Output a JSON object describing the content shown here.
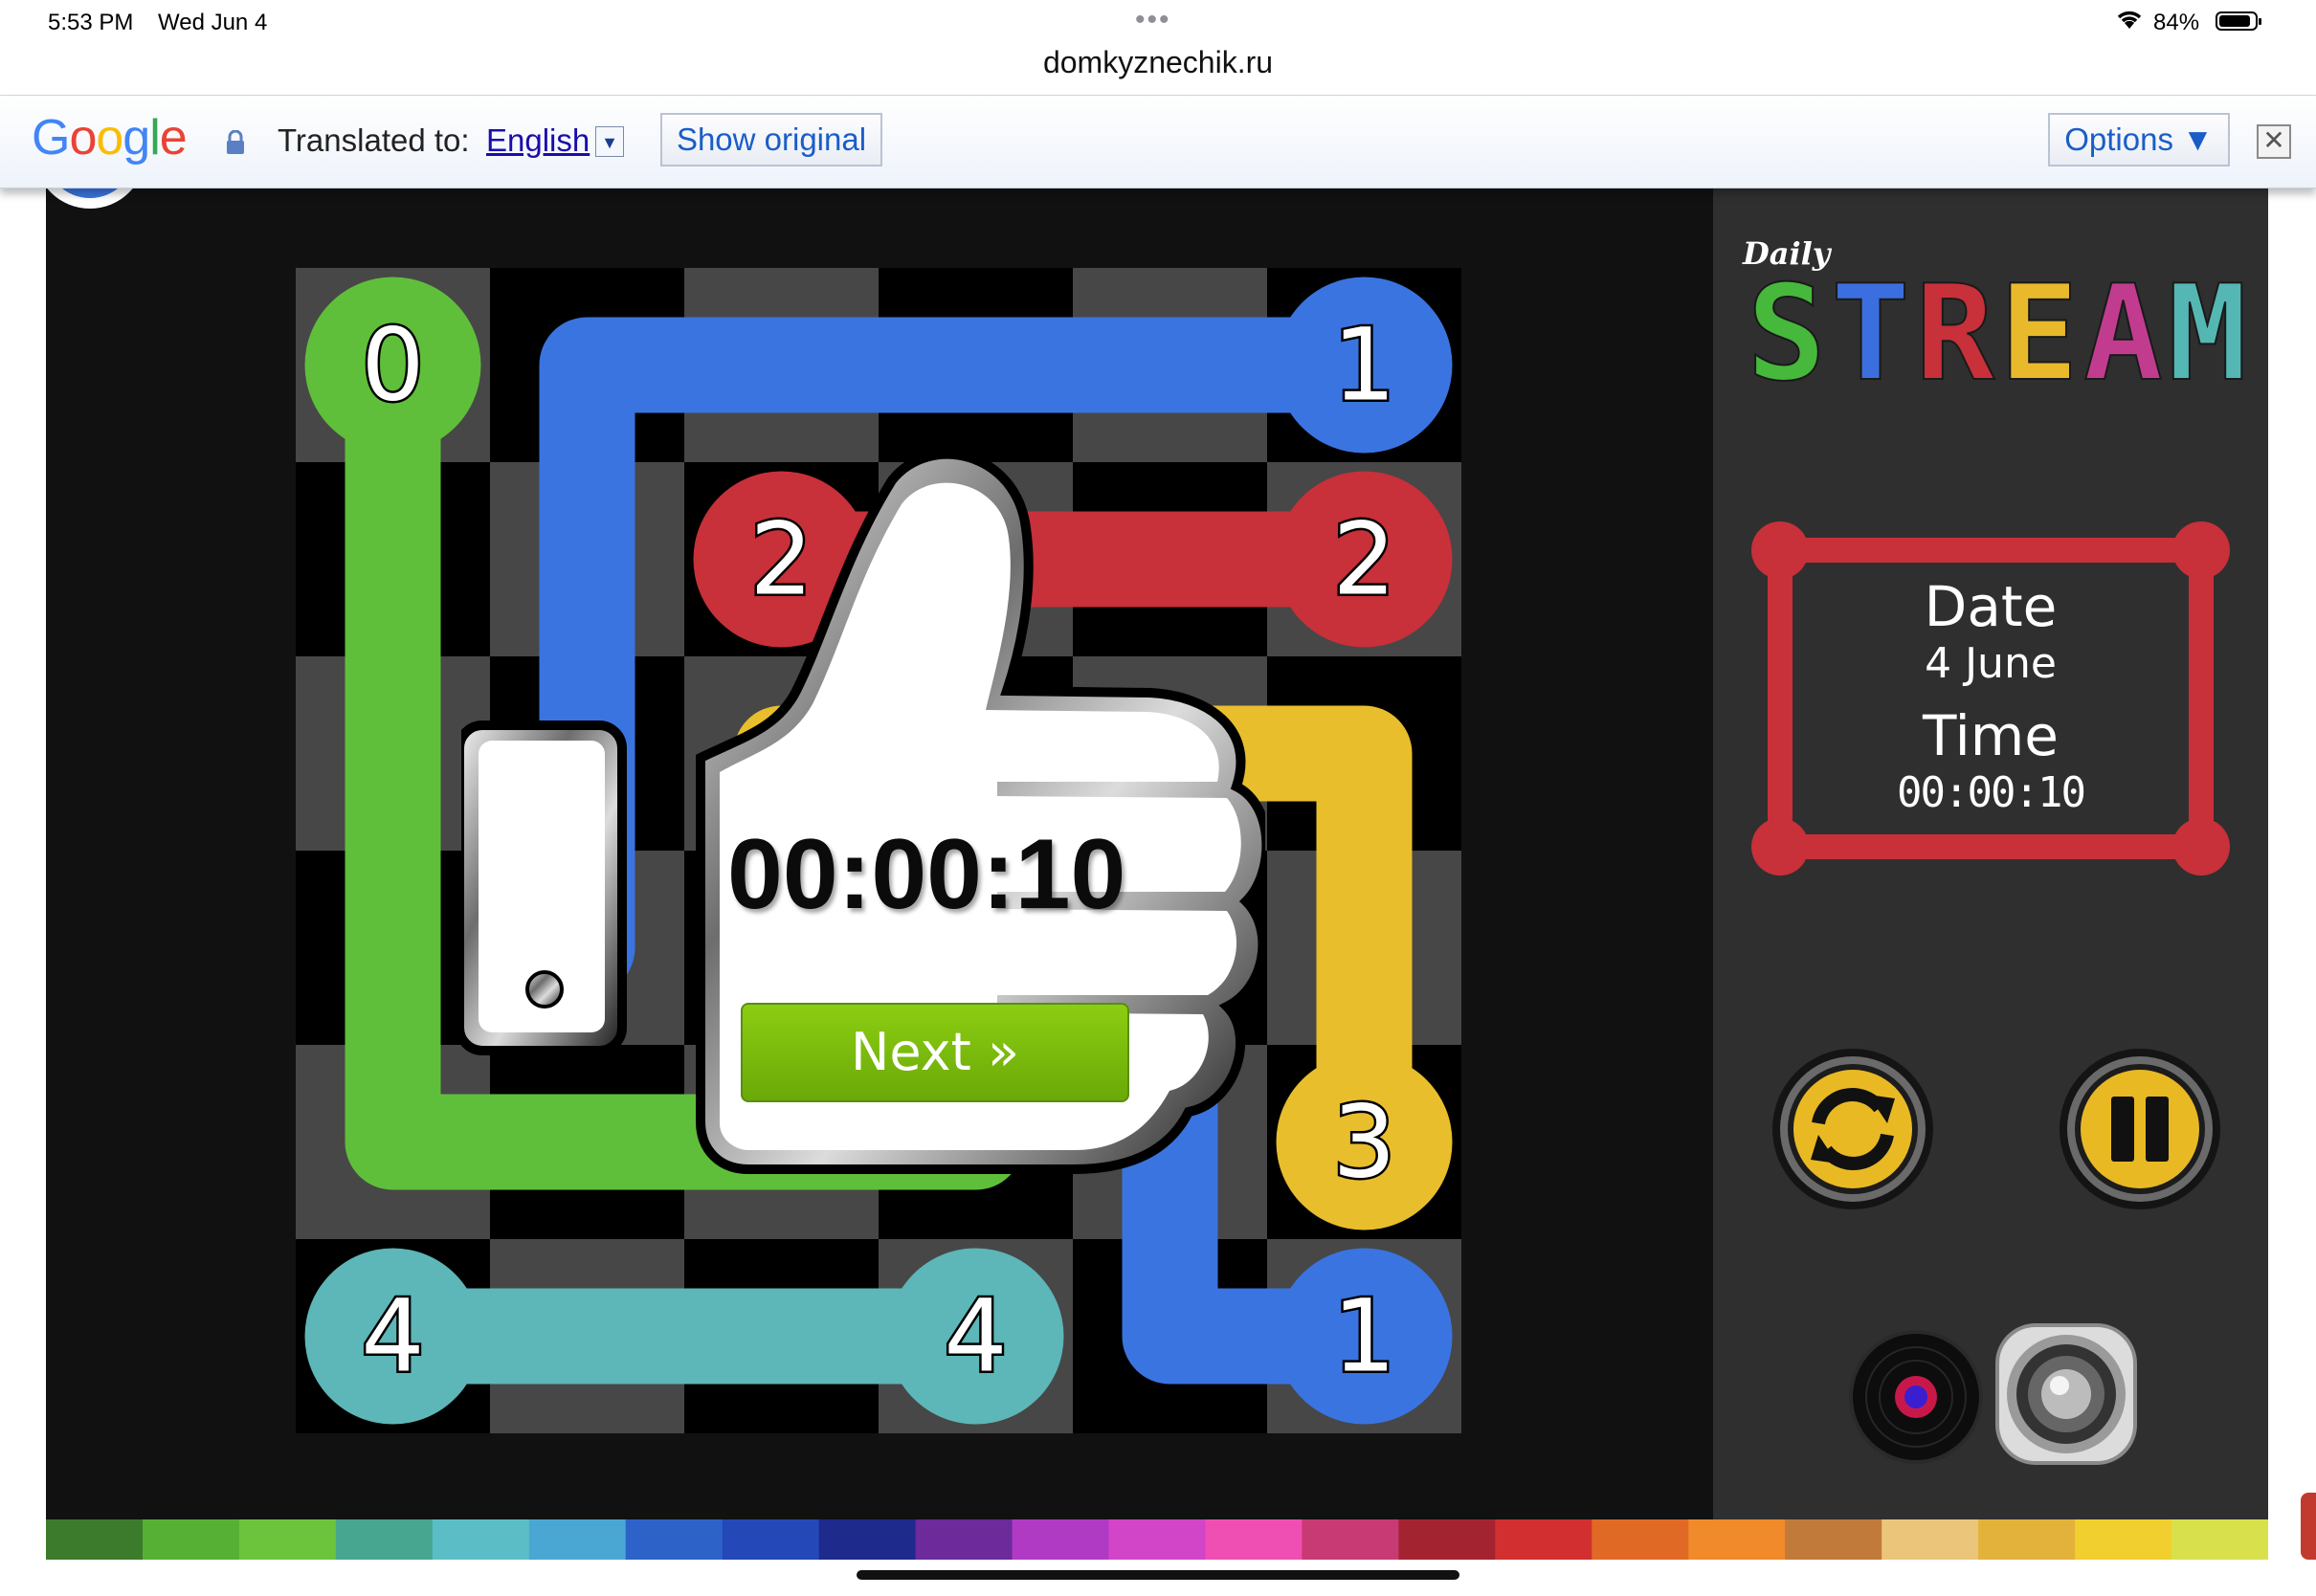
{
  "status_bar": {
    "time": "5:53 PM",
    "date": "Wed Jun 4",
    "battery_percent": "84%",
    "battery_level": 0.84
  },
  "browser": {
    "url": "domkyznechik.ru"
  },
  "translate_bar": {
    "logo": "Google",
    "translated_to_label": "Translated to:",
    "language": "English",
    "show_original_label": "Show original",
    "options_label": "Options ▼",
    "close_glyph": "✕",
    "dropdown_glyph": "▼"
  },
  "game": {
    "logo_small": "Daily",
    "logo_big": "STREAM",
    "logo_colors": [
      "#46b83b",
      "#3b6fe0",
      "#c8303a",
      "#e8b92b",
      "#c13c8f",
      "#54b7b4"
    ],
    "info": {
      "date_label": "Date",
      "date_value": "4 June",
      "time_label": "Time",
      "time_value": "00:00:10"
    },
    "overlay": {
      "time": "00:00:10",
      "next_label": "Next »"
    },
    "controls": [
      "restart-icon",
      "pause-icon",
      "music-record-icon",
      "speaker-icon"
    ],
    "colors": {
      "green": "#5fbf3a",
      "blue": "#3a74e0",
      "red": "#c8303a",
      "yellow": "#e8be2c",
      "teal": "#5db6b7",
      "cell_dark": "#000000",
      "cell_light": "#474747"
    },
    "grid_size": 6,
    "endpoints": [
      {
        "label": "0",
        "color": "green",
        "row": 0,
        "col": 0
      },
      {
        "label": "1",
        "color": "blue",
        "row": 0,
        "col": 5
      },
      {
        "label": "2",
        "color": "red",
        "row": 1,
        "col": 2
      },
      {
        "label": "2",
        "color": "red",
        "row": 1,
        "col": 5
      },
      {
        "label": "3",
        "color": "yellow",
        "row": 4,
        "col": 5
      },
      {
        "label": "4",
        "color": "teal",
        "row": 5,
        "col": 0
      },
      {
        "label": "4",
        "color": "teal",
        "row": 5,
        "col": 3
      },
      {
        "label": "1",
        "color": "blue",
        "row": 5,
        "col": 5
      }
    ],
    "paths": [
      {
        "color": "green",
        "cells": [
          [
            0,
            0
          ],
          [
            1,
            0
          ],
          [
            2,
            0
          ],
          [
            3,
            0
          ],
          [
            4,
            0
          ],
          [
            4,
            1
          ],
          [
            4,
            2
          ],
          [
            4,
            3
          ],
          [
            3,
            3
          ]
        ]
      },
      {
        "color": "blue",
        "cells": [
          [
            0,
            5
          ],
          [
            0,
            4
          ],
          [
            0,
            3
          ],
          [
            0,
            2
          ],
          [
            0,
            1
          ],
          [
            1,
            1
          ],
          [
            2,
            1
          ],
          [
            3,
            1
          ]
        ]
      },
      {
        "color": "blue",
        "cells": [
          [
            5,
            5
          ],
          [
            5,
            4
          ],
          [
            4,
            4
          ],
          [
            3,
            4
          ]
        ]
      },
      {
        "color": "red",
        "cells": [
          [
            1,
            2
          ],
          [
            1,
            3
          ],
          [
            1,
            4
          ],
          [
            1,
            5
          ]
        ]
      },
      {
        "color": "yellow",
        "cells": [
          [
            2,
            2
          ],
          [
            2,
            3
          ],
          [
            2,
            4
          ],
          [
            2,
            5
          ],
          [
            3,
            5
          ],
          [
            4,
            5
          ]
        ]
      },
      {
        "color": "teal",
        "cells": [
          [
            5,
            0
          ],
          [
            5,
            1
          ],
          [
            5,
            2
          ],
          [
            5,
            3
          ]
        ]
      }
    ]
  }
}
